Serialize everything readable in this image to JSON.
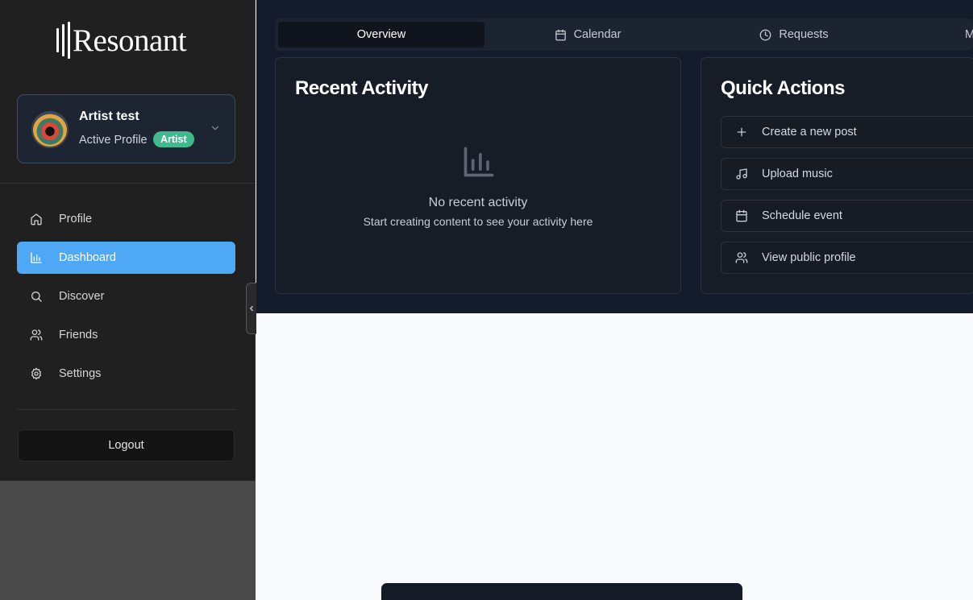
{
  "brand": {
    "name": "Resonant"
  },
  "profile": {
    "name": "Artist test",
    "status": "Active Profile",
    "badge": "Artist"
  },
  "nav": {
    "items": [
      {
        "label": "Profile",
        "icon": "home-icon"
      },
      {
        "label": "Dashboard",
        "icon": "bar-chart-icon",
        "active": true
      },
      {
        "label": "Discover",
        "icon": "search-icon"
      },
      {
        "label": "Friends",
        "icon": "users-icon"
      },
      {
        "label": "Settings",
        "icon": "gear-icon"
      }
    ],
    "logout": "Logout"
  },
  "tabs": [
    {
      "label": "Overview",
      "active": true
    },
    {
      "label": "Calendar",
      "icon": "calendar-icon"
    },
    {
      "label": "Requests",
      "icon": "clock-icon"
    },
    {
      "label": "M"
    }
  ],
  "recent_activity": {
    "title": "Recent Activity",
    "empty_title": "No recent activity",
    "empty_subtitle": "Start creating content to see your activity here"
  },
  "quick_actions": {
    "title": "Quick Actions",
    "items": [
      {
        "label": "Create a new post",
        "icon": "plus-icon"
      },
      {
        "label": "Upload music",
        "icon": "music-note-icon"
      },
      {
        "label": "Schedule event",
        "icon": "calendar-icon"
      },
      {
        "label": "View public profile",
        "icon": "users-icon"
      }
    ]
  },
  "colors": {
    "accent": "#4ea8f5",
    "badge": "#3fba8c",
    "sidebar_bg": "#202020",
    "main_bg": "#141b2a"
  }
}
